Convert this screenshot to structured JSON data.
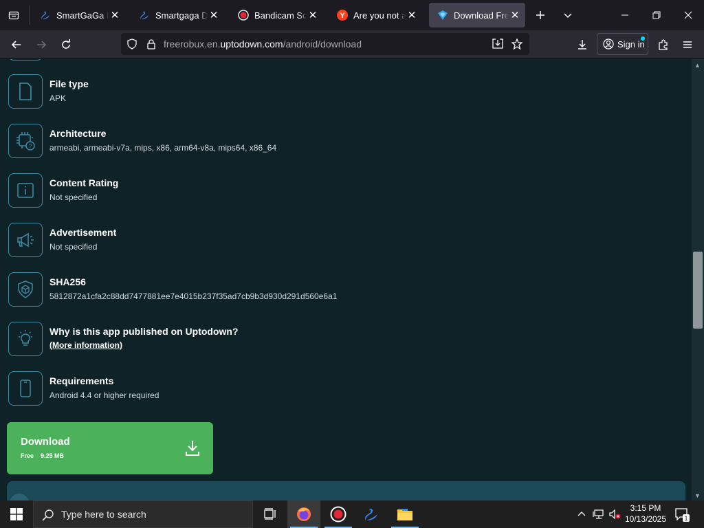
{
  "browser": {
    "tabs": [
      {
        "title": "SmartGaGa Dow",
        "favicon": "smartgaga-swan-icon",
        "active": false
      },
      {
        "title": "Smartgaga Dow",
        "favicon": "smartgaga-swan-icon",
        "active": false
      },
      {
        "title": "Bandicam Screen",
        "favicon": "bandicam-record-icon",
        "active": false
      },
      {
        "title": "Are you not a ro",
        "favicon": "yandex-y-icon",
        "active": false
      },
      {
        "title": "Download FreeR",
        "favicon": "uptodown-arrow-icon",
        "active": true
      }
    ],
    "url_prefix": "freerobux.en.",
    "url_host": "uptodown.com",
    "url_path": "/android/download",
    "signin_label": "Sign in"
  },
  "details": [
    {
      "label": "File type",
      "value": "APK",
      "icon": "file-icon"
    },
    {
      "label": "Architecture",
      "value": "armeabi, armeabi-v7a, mips, x86, arm64-v8a, mips64, x86_64",
      "icon": "chip-icon"
    },
    {
      "label": "Content Rating",
      "value": "Not specified",
      "icon": "info-icon"
    },
    {
      "label": "Advertisement",
      "value": "Not specified",
      "icon": "megaphone-icon"
    },
    {
      "label": "SHA256",
      "value": "5812872a1cfa2c88dd7477881ee7e4015b237f35ad7cb9b3d930d291d560e6a1",
      "icon": "shield-icon"
    },
    {
      "label": "Why is this app published on Uptodown?",
      "value": "(More information)",
      "icon": "lightbulb-icon"
    },
    {
      "label": "Requirements",
      "value": "Android 4.4 or higher required",
      "icon": "phone-icon"
    }
  ],
  "download": {
    "label": "Download",
    "price": "Free",
    "size": "9.25 MB"
  },
  "taskbar": {
    "search_placeholder": "Type here to search",
    "time": "3:15 PM",
    "date": "10/13/2025",
    "notification_count": "1"
  },
  "colors": {
    "page_bg": "#0f2228",
    "icon_border": "#3d8ea5",
    "download_green": "#4bb15a"
  }
}
